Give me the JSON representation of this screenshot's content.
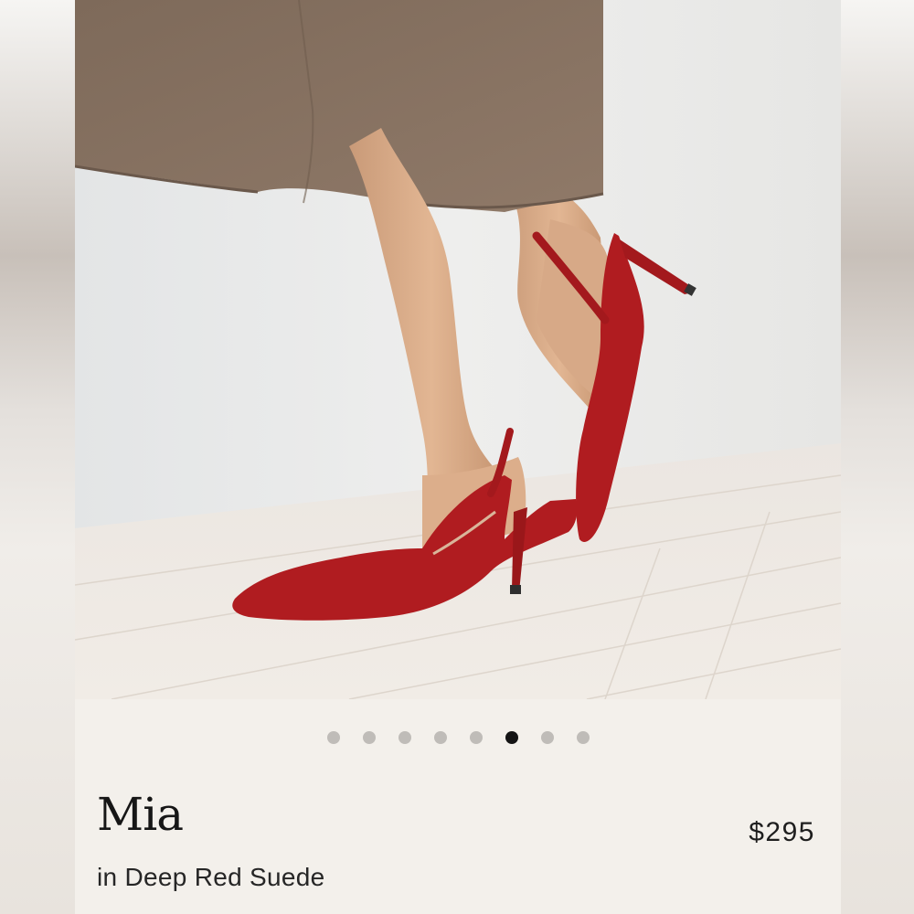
{
  "product": {
    "name": "Mia",
    "variant": "in Deep Red Suede",
    "price": "$295"
  },
  "carousel": {
    "total_slides": 8,
    "active_index": 5,
    "image_alt": "photo-of-red-suede-slingback-heels"
  },
  "colors": {
    "shoe": "#b01c20",
    "skirt": "#8a7463",
    "background": "#f3f0eb",
    "dot_inactive": "#bfbcb8",
    "dot_active": "#141414"
  }
}
